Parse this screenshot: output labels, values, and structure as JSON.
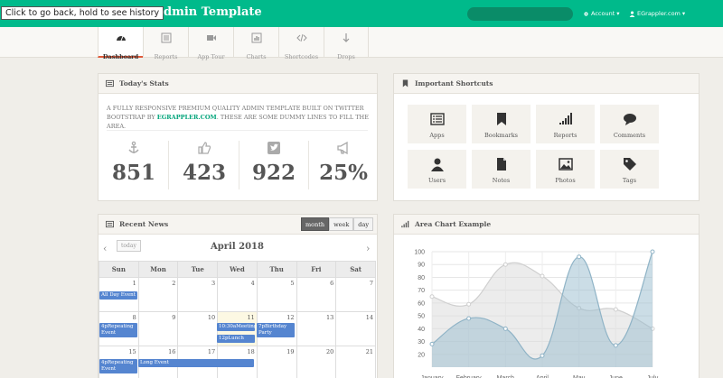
{
  "header": {
    "brand": "rap Admin Template",
    "tooltip": "Click to go back, hold to see history",
    "search_placeholder": "",
    "account_label": "Account",
    "user_label": "EGrappler.com"
  },
  "subnav": [
    {
      "label": "Dashboard",
      "icon": "dashboard-icon",
      "active": true
    },
    {
      "label": "Reports",
      "icon": "list-icon"
    },
    {
      "label": "App Tour",
      "icon": "video-icon"
    },
    {
      "label": "Charts",
      "icon": "bar-chart-icon"
    },
    {
      "label": "Shortcodes",
      "icon": "code-icon"
    },
    {
      "label": "Drops",
      "icon": "arrow-down-icon"
    }
  ],
  "stats": {
    "title": "Today's Stats",
    "intro_text": "A fully responsive premium quality admin template built on Twitter Bootstrap by",
    "intro_link": "EGrappler.com",
    "intro_text2": ". These are some dummy lines to fill the area.",
    "items": [
      {
        "icon": "anchor-icon",
        "value": "851"
      },
      {
        "icon": "thumbs-up-icon",
        "value": "423"
      },
      {
        "icon": "twitter-icon",
        "value": "922"
      },
      {
        "icon": "bullhorn-icon",
        "value": "25%"
      }
    ]
  },
  "shortcuts": {
    "title": "Important Shortcuts",
    "items": [
      {
        "label": "Apps",
        "icon": "list-icon"
      },
      {
        "label": "Bookmarks",
        "icon": "bookmark-icon"
      },
      {
        "label": "Reports",
        "icon": "signal-icon"
      },
      {
        "label": "Comments",
        "icon": "comment-icon"
      },
      {
        "label": "Users",
        "icon": "user-icon"
      },
      {
        "label": "Notes",
        "icon": "file-icon"
      },
      {
        "label": "Photos",
        "icon": "picture-icon"
      },
      {
        "label": "Tags",
        "icon": "tag-icon"
      }
    ]
  },
  "news": {
    "title": "Recent News",
    "view_buttons": [
      "month",
      "week",
      "day"
    ],
    "active_view": "month",
    "today_label": "today",
    "month_title": "April 2018",
    "weekdays": [
      "Sun",
      "Mon",
      "Tue",
      "Wed",
      "Thu",
      "Fri",
      "Sat"
    ],
    "weeks": [
      [
        "1",
        "2",
        "3",
        "4",
        "5",
        "6",
        "7"
      ],
      [
        "8",
        "9",
        "10",
        "11",
        "12",
        "13",
        "14"
      ],
      [
        "15",
        "16",
        "17",
        "18",
        "19",
        "20",
        "21"
      ]
    ],
    "events": {
      "all_day": "All Day Event",
      "repeating1": "4pRepeating Event",
      "meeting": "10:30aMeeting",
      "lunch": "12pLunch",
      "birthday": "7pBirthday Party",
      "repeating2": "4pRepeating Event",
      "long": "Long Event"
    }
  },
  "area_chart_title": "Area Chart Example",
  "chart_data": {
    "type": "area",
    "categories": [
      "January",
      "February",
      "March",
      "April",
      "May",
      "June",
      "July"
    ],
    "ylim": [
      10,
      100
    ],
    "yticks": [
      "100",
      "90",
      "80",
      "70",
      "60",
      "50",
      "40",
      "30",
      "20"
    ],
    "series": [
      {
        "values": [
          65,
          59,
          90,
          81,
          56,
          55,
          40
        ],
        "color": "#dcdcdc"
      },
      {
        "values": [
          28,
          48,
          40,
          19,
          96,
          27,
          100
        ],
        "color": "#97bbcd"
      }
    ]
  }
}
